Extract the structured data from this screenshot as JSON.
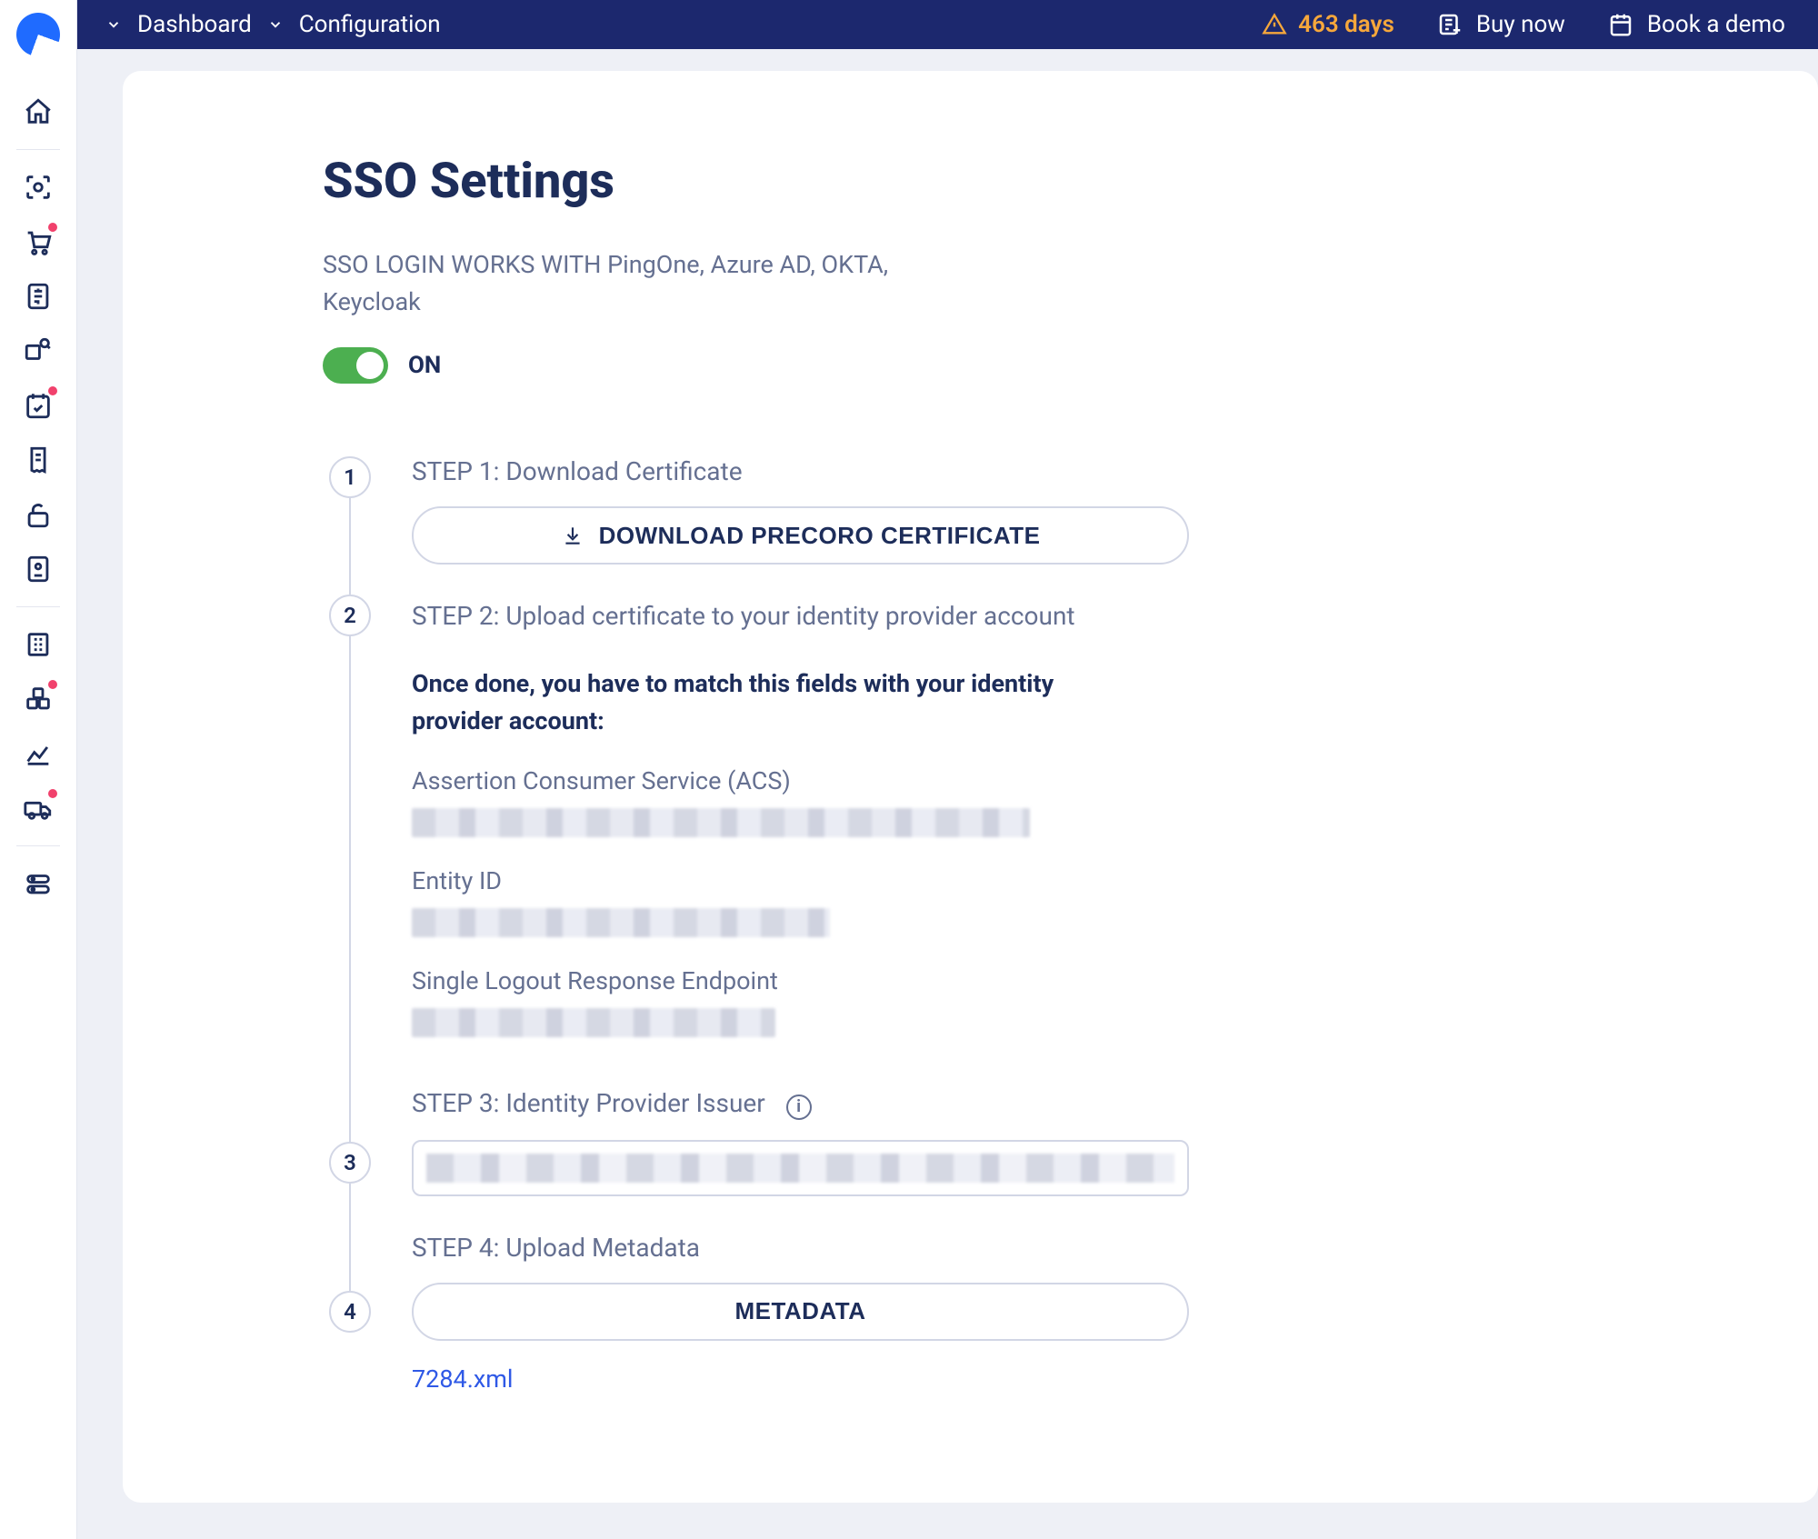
{
  "topnav": {
    "breadcrumb1": "Dashboard",
    "breadcrumb2": "Configuration",
    "days_warning": "463 days",
    "buy": "Buy now",
    "demo": "Book a demo"
  },
  "page": {
    "title": "SSO Settings",
    "subtitle": "SSO LOGIN WORKS WITH PingOne, Azure AD, OKTA, Keycloak",
    "toggle_state": "ON"
  },
  "steps": {
    "s1": {
      "num": "1",
      "title": "STEP 1: Download Certificate",
      "button": "DOWNLOAD PRECORO CERTIFICATE"
    },
    "s2": {
      "num": "2",
      "title": "STEP 2: Upload certificate to your identity provider account",
      "note": "Once done, you have to match this fields with your identity provider account:",
      "f1": "Assertion Consumer Service (ACS)",
      "f2": "Entity ID",
      "f3": "Single Logout Response Endpoint"
    },
    "s3": {
      "num": "3",
      "title": "STEP 3: Identity Provider Issuer"
    },
    "s4": {
      "num": "4",
      "title": "STEP 4: Upload Metadata",
      "button": "METADATA",
      "file": "7284.xml"
    }
  }
}
